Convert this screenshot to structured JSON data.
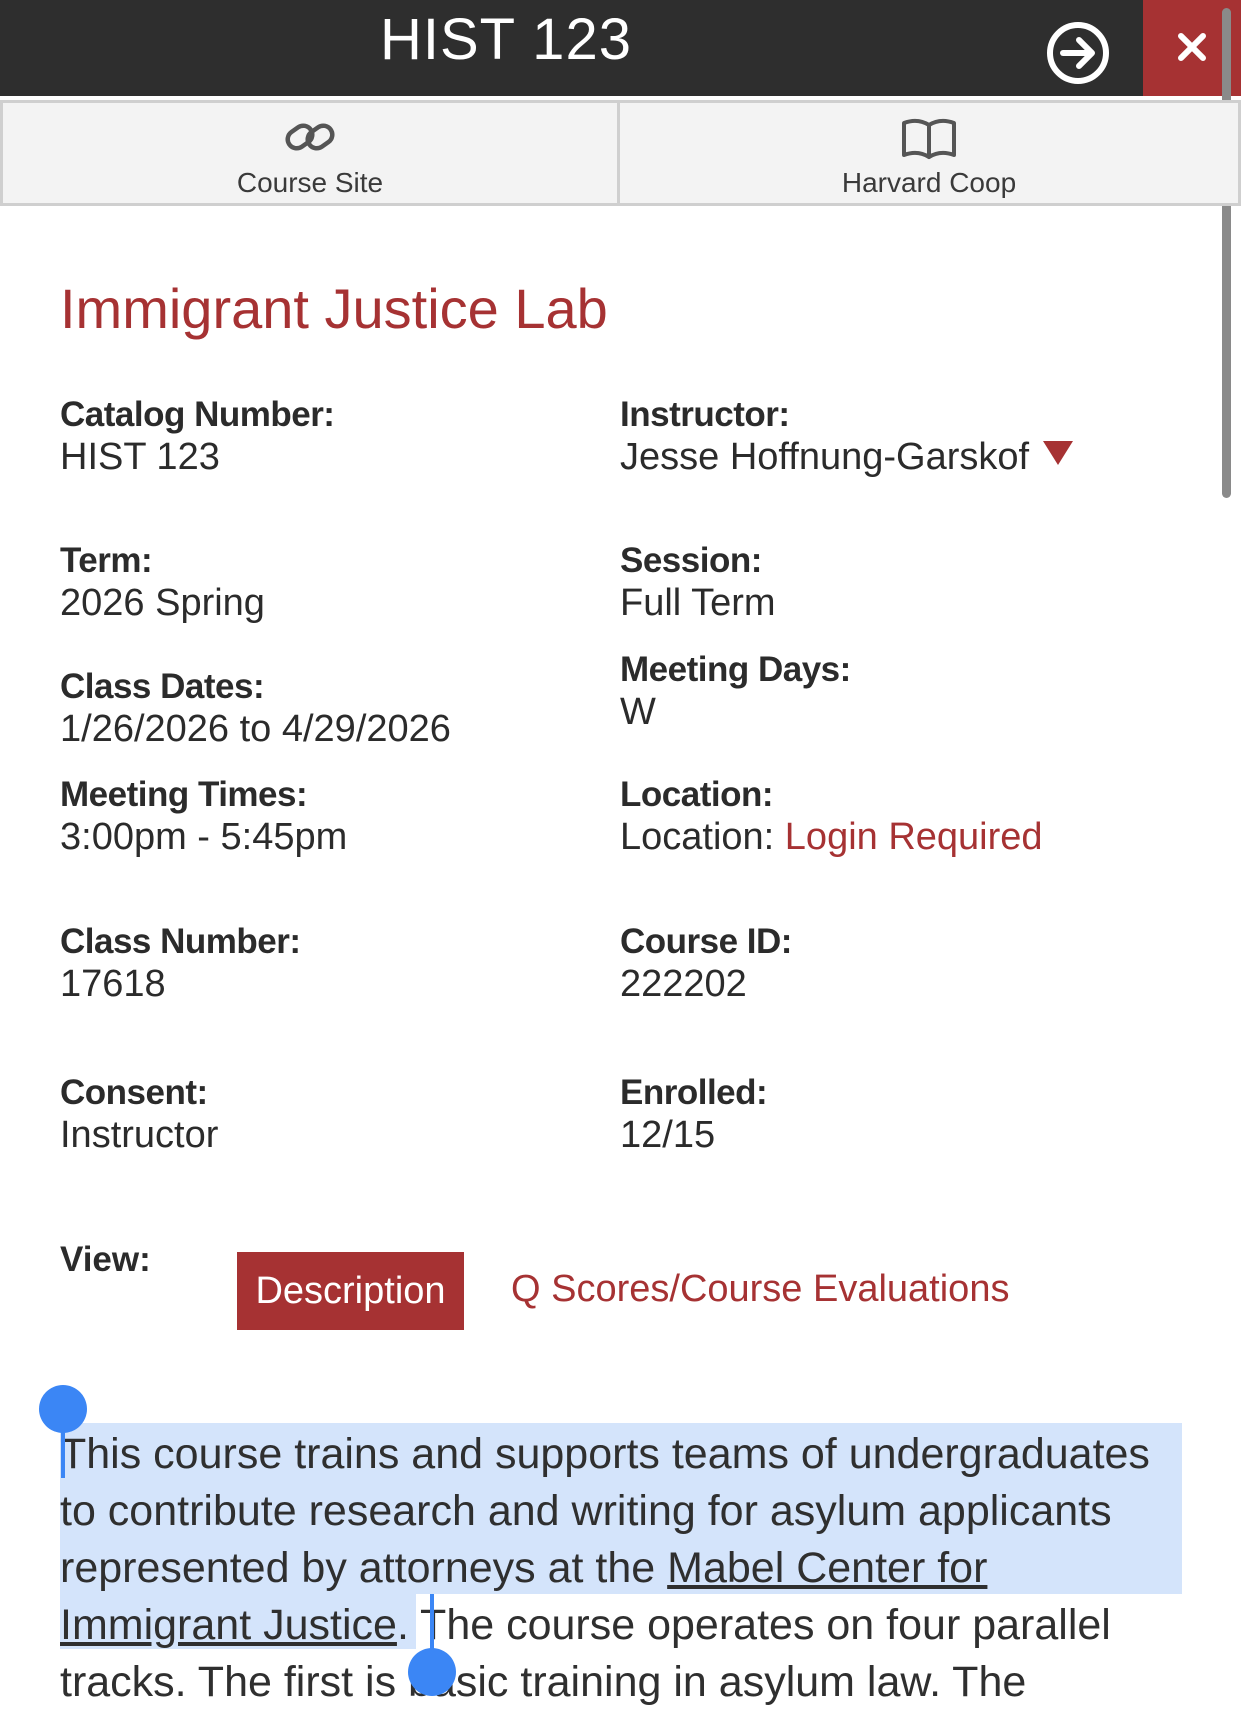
{
  "header": {
    "title": "HIST 123",
    "go_icon": "arrow-right-circle-icon",
    "close_icon": "close-icon"
  },
  "tabs": [
    {
      "label": "Course Site",
      "icon": "link-icon"
    },
    {
      "label": "Harvard Coop",
      "icon": "book-icon"
    }
  ],
  "course": {
    "title": "Immigrant Justice Lab"
  },
  "fields": {
    "catalog_number": {
      "label": "Catalog Number:",
      "value": "HIST 123"
    },
    "instructor": {
      "label": "Instructor:",
      "value": "Jesse Hoffnung-Garskof"
    },
    "term": {
      "label": "Term:",
      "value": "2026 Spring"
    },
    "session": {
      "label": "Session:",
      "value": "Full Term"
    },
    "class_dates": {
      "label": "Class Dates:",
      "value": "1/26/2026 to 4/29/2026"
    },
    "meeting_days": {
      "label": "Meeting Days:",
      "value": "W"
    },
    "meeting_times": {
      "label": "Meeting Times:",
      "value": "3:00pm - 5:45pm"
    },
    "location": {
      "label": "Location:",
      "prefix": "Location:",
      "link": "Login Required"
    },
    "class_number": {
      "label": "Class Number:",
      "value": "17618"
    },
    "course_id": {
      "label": "Course ID:",
      "value": "222202"
    },
    "consent": {
      "label": "Consent:",
      "value": "Instructor"
    },
    "enrolled": {
      "label": "Enrolled:",
      "value": "12/15"
    }
  },
  "view": {
    "label": "View:",
    "description_button": "Description",
    "q_scores_link": "Q Scores/Course Evaluations"
  },
  "description": {
    "line1": "This course trains and supports teams of undergraduates",
    "line2": "to contribute research and writing for asylum applicants",
    "line3_text": "represented by attorneys at the ",
    "line3_link": "Mabel Center for",
    "line4_link": "Immigrant Justice",
    "line4_text": ". The course operates on four parallel",
    "line5": "tracks. The first is basic training in asylum law.  The"
  },
  "colors": {
    "header_bg": "#2e2e2e",
    "accent": "#a63233",
    "selection": "#d4e4fb",
    "selection_handle": "#3b86f5"
  }
}
